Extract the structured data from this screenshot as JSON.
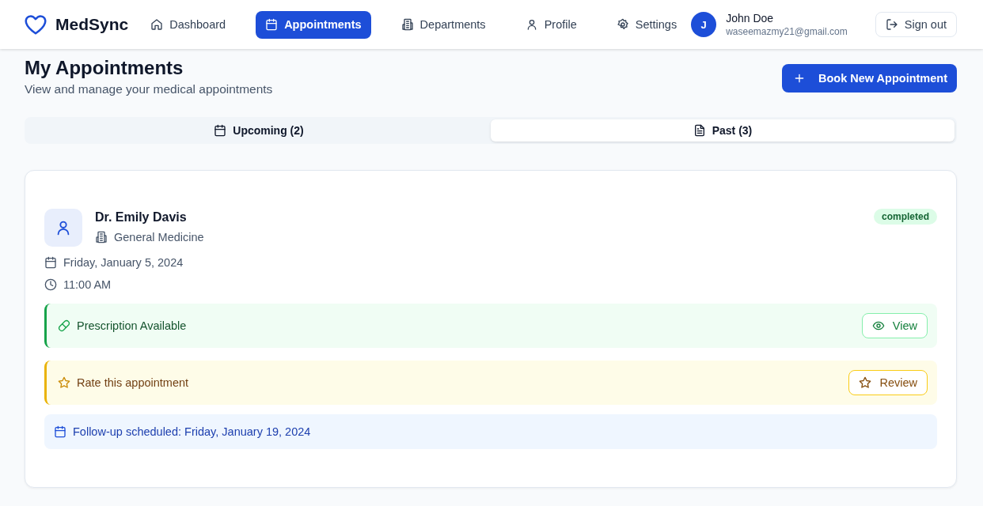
{
  "brand": {
    "name": "MedSync"
  },
  "nav": [
    {
      "label": "Dashboard",
      "selected": false
    },
    {
      "label": "Appointments",
      "selected": true
    },
    {
      "label": "Departments",
      "selected": false
    },
    {
      "label": "Profile",
      "selected": false
    },
    {
      "label": "Settings",
      "selected": false
    }
  ],
  "user": {
    "initial": "J",
    "name": "John Doe",
    "email": "waseemazmy21@gmail.com"
  },
  "sign_out": "Sign out",
  "page": {
    "title": "My Appointments",
    "subtitle": "View and manage your medical appointments",
    "book_button": "Book New Appointment"
  },
  "tabs": [
    {
      "label": "Upcoming (2)",
      "selected": false
    },
    {
      "label": "Past (3)",
      "selected": true
    }
  ],
  "appointment": {
    "doctor": "Dr. Emily Davis",
    "department": "General Medicine",
    "status": "completed",
    "date": "Friday, January 5, 2024",
    "time": "11:00 AM",
    "notices": [
      {
        "kind": "prescription",
        "text": "Prescription Available",
        "button": "View"
      },
      {
        "kind": "rating",
        "text": "Rate this appointment",
        "button": "Review"
      },
      {
        "kind": "followup",
        "text": "Follow-up scheduled: Friday, January 19, 2024"
      }
    ]
  }
}
